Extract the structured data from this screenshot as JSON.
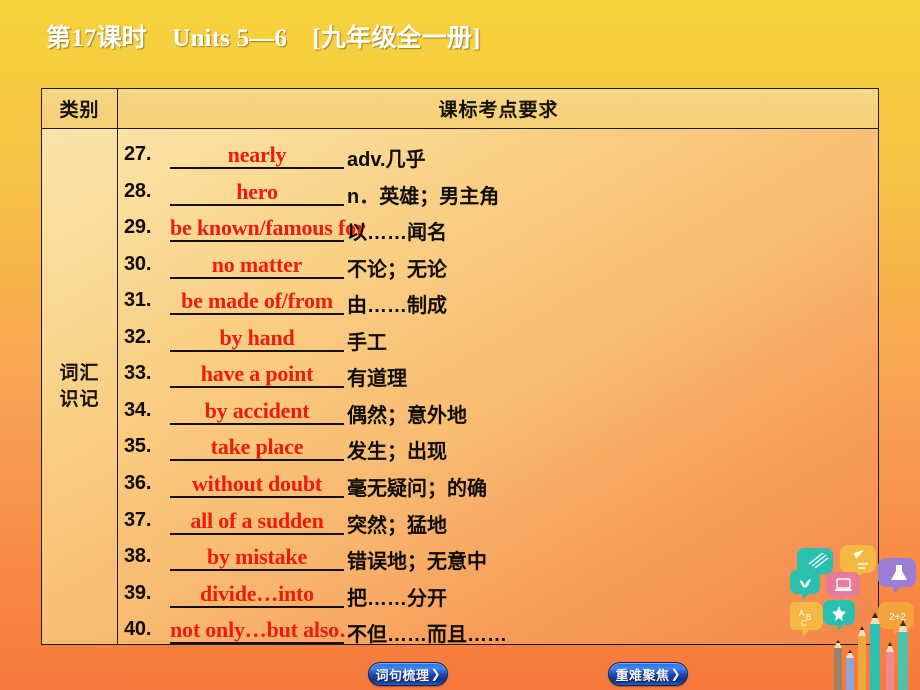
{
  "slide": {
    "title": "第17课时　Units 5—6　[九年级全一册]",
    "background_top_color": "#f5d23a",
    "background_bottom_color": "#f5793b",
    "answer_color": "#ec1c10",
    "text_color": "#100c04"
  },
  "table": {
    "headers": [
      "类别",
      "课标考点要求"
    ],
    "category_label_lines": [
      "词汇",
      "识记"
    ],
    "rows": [
      {
        "num": "27.",
        "answer": "nearly",
        "meaning": "adv.几乎",
        "blank_width": 112
      },
      {
        "num": "28.",
        "answer": "hero",
        "meaning": "n．英雄；男主角",
        "blank_width": 112
      },
      {
        "num": "29.",
        "answer": "be known/famous for",
        "meaning": "以……闻名",
        "blank_width": 112
      },
      {
        "num": "30.",
        "answer": "no matter",
        "meaning": "不论；无论",
        "blank_width": 112
      },
      {
        "num": "31.",
        "answer": "be made of/from",
        "meaning": "由……制成",
        "blank_width": 112
      },
      {
        "num": "32.",
        "answer": "by hand",
        "meaning": "手工",
        "blank_width": 112
      },
      {
        "num": "33.",
        "answer": "have a point",
        "meaning": "有道理",
        "blank_width": 112
      },
      {
        "num": "34.",
        "answer": "by accident",
        "meaning": "偶然；意外地",
        "blank_width": 112
      },
      {
        "num": "35.",
        "answer": "take place",
        "meaning": "发生；出现",
        "blank_width": 112
      },
      {
        "num": "36.",
        "answer": "without doubt",
        "meaning": "毫无疑问；的确",
        "blank_width": 112
      },
      {
        "num": "37.",
        "answer": "all of a sudden",
        "meaning": "突然；猛地",
        "blank_width": 112
      },
      {
        "num": "38.",
        "answer": "by mistake",
        "meaning": "错误地；无意中",
        "blank_width": 112
      },
      {
        "num": "39.",
        "answer": "divide…into",
        "meaning": "把……分开",
        "blank_width": 112
      },
      {
        "num": "40.",
        "answer": "not only…but also…",
        "meaning": "不但……而且……",
        "blank_width": 112
      }
    ]
  },
  "nav": {
    "left_button": {
      "label": "词句梳理",
      "chevron": "❯"
    },
    "right_button": {
      "label": "重难聚焦",
      "chevron": "❯"
    }
  },
  "decorations": {
    "icons": [
      "speech-bubble-notebook-icon",
      "speech-bubble-pen-icon",
      "speech-bubble-flask-icon",
      "speech-bubble-laptop-icon",
      "speech-bubble-plant-icon",
      "speech-bubble-abc-icon",
      "speech-bubble-star-icon",
      "speech-bubble-math-icon",
      "colored-pencils-icon"
    ]
  }
}
